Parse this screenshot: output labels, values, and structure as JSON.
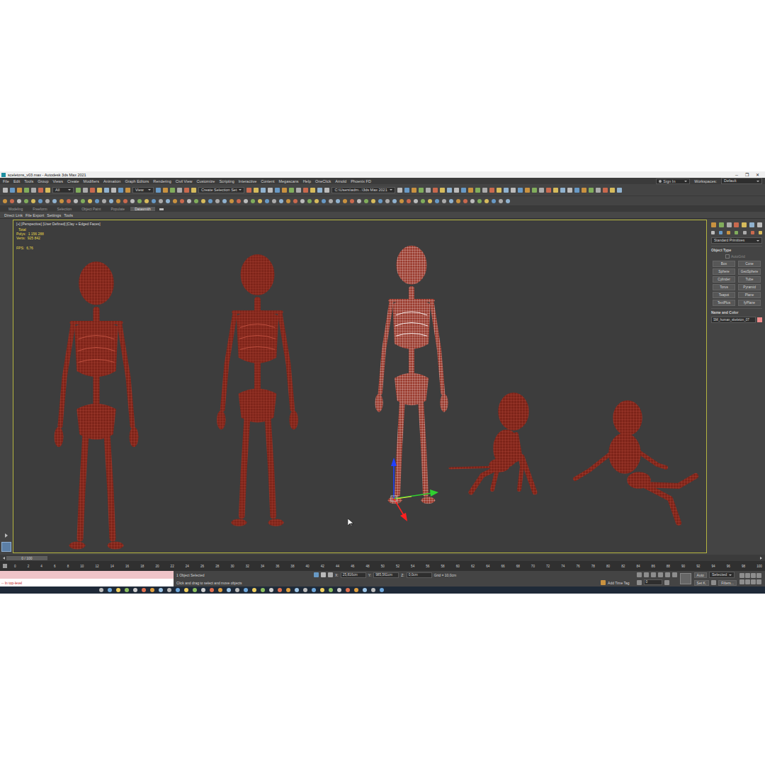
{
  "window": {
    "title": "sceletons_v03.max - Autodesk 3ds Max 2021",
    "controls": [
      "─",
      "❐",
      "✕"
    ]
  },
  "menu": [
    "File",
    "Edit",
    "Tools",
    "Group",
    "Views",
    "Create",
    "Modifiers",
    "Animation",
    "Graph Editors",
    "Rendering",
    "Civil View",
    "Customize",
    "Scripting",
    "Interactive",
    "Content",
    "Megascans",
    "Help",
    "OneClick",
    "Arnold",
    "Phoenix FD"
  ],
  "account": {
    "sign_in": "Sign In",
    "workspaces_label": "Workspaces:",
    "workspace": "Default"
  },
  "toolbar": {
    "selection_filter": "All",
    "reference": "View",
    "selection_set": "Create Selection Set",
    "project_path": "C:\\Users\\adm...\\3ds Max 2021"
  },
  "ribbon_tabs": [
    {
      "label": "Modeling",
      "selected": false
    },
    {
      "label": "Freeform",
      "selected": false
    },
    {
      "label": "Selection",
      "selected": false
    },
    {
      "label": "Object Paint",
      "selected": false
    },
    {
      "label": "Populate",
      "selected": false
    },
    {
      "label": "Datasmith",
      "selected": true
    }
  ],
  "ribbon_tools": [
    "Direct Link",
    "File Export",
    "Settings",
    "Tools"
  ],
  "viewport": {
    "label": "[+] [Perspective] [User Defined] [Clay + Edged Faces]",
    "stats": [
      {
        "label": "",
        "value": "Total"
      },
      {
        "label": "Polys:",
        "value": "1 156 288"
      },
      {
        "label": "Verts:",
        "value": "925 842"
      }
    ],
    "fps": {
      "label": "FPS:",
      "value": "6,76"
    },
    "skeletons": [
      {
        "pose": "standing",
        "selected": false
      },
      {
        "pose": "standing",
        "selected": false
      },
      {
        "pose": "standing",
        "selected": true
      },
      {
        "pose": "crouching",
        "selected": false
      },
      {
        "pose": "sitting",
        "selected": false
      }
    ]
  },
  "command_panel": {
    "category": "Standard Primitives",
    "object_type_title": "Object Type",
    "autogrid": "AutoGrid",
    "buttons": [
      "Box",
      "Cone",
      "Sphere",
      "GeoSphere",
      "Cylinder",
      "Tube",
      "Torus",
      "Pyramid",
      "Teapot",
      "Plane",
      "TextPlus",
      "fyPlane"
    ],
    "name_and_color_title": "Name and Color",
    "object_name": "SM_human_skeleton_07"
  },
  "timeline": {
    "frame": "0 / 100",
    "ticks": [
      "0",
      "2",
      "4",
      "6",
      "8",
      "10",
      "12",
      "14",
      "16",
      "18",
      "20",
      "22",
      "24",
      "26",
      "28",
      "30",
      "32",
      "34",
      "36",
      "38",
      "40",
      "42",
      "44",
      "46",
      "48",
      "50",
      "52",
      "54",
      "56",
      "58",
      "60",
      "62",
      "64",
      "66",
      "68",
      "70",
      "72",
      "74",
      "76",
      "78",
      "80",
      "82",
      "84",
      "86",
      "88",
      "90",
      "92",
      "94",
      "96",
      "98",
      "100"
    ]
  },
  "status": {
    "maxscript": "-- In top-level",
    "selection": "1 Object Selected",
    "prompt": "Click and drag to select and move objects",
    "x_label": "X:",
    "x": "25,816cm",
    "y_label": "Y:",
    "y": "985,561cm",
    "z_label": "Z:",
    "z": "0,0cm",
    "grid": "Grid = 10,0cm",
    "time_tag": "Add Time Tag",
    "auto_key": "Auto",
    "key_filter": "Selected",
    "set_key": "Set K.",
    "filters": "Filters...",
    "frame": "0"
  }
}
